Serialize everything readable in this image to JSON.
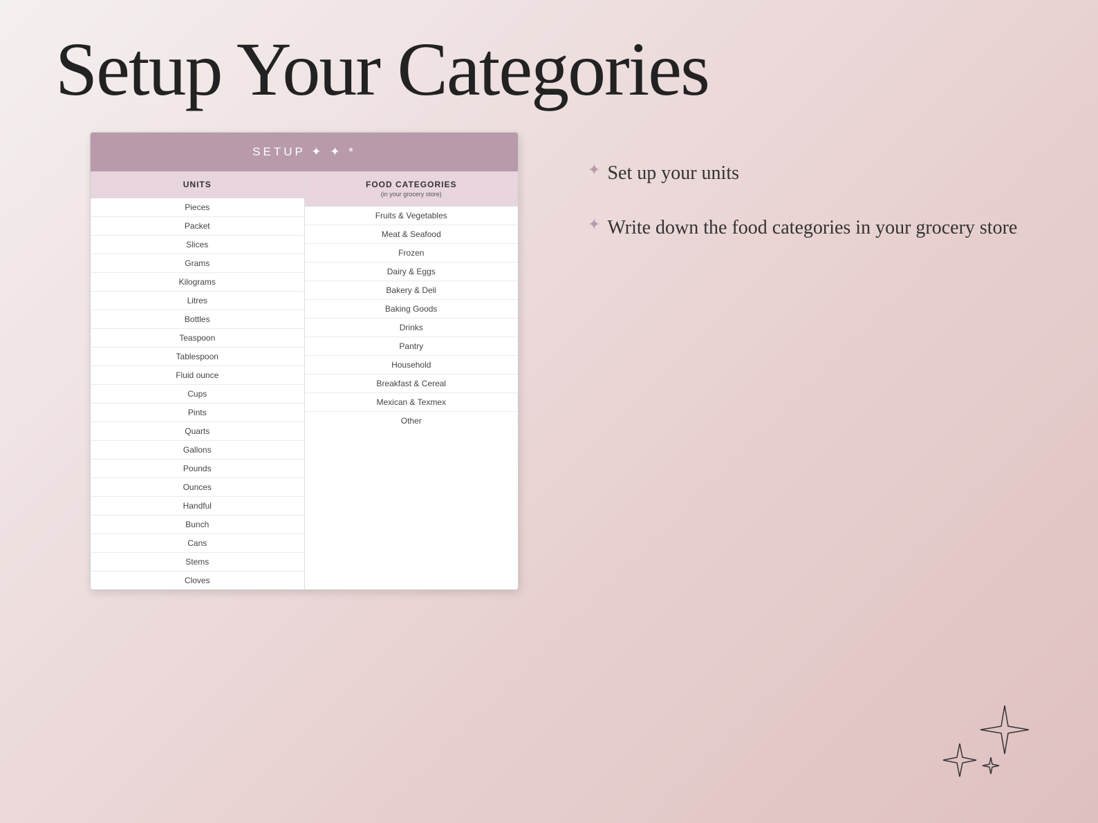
{
  "page": {
    "title": "Setup Your Categories",
    "background": "linear-gradient pink"
  },
  "card": {
    "header": "SETUP ✦ ✦ *",
    "units_col_header": "UNITS",
    "food_col_header": "FOOD CATEGORIES",
    "food_col_subheader": "(in your grocery store)",
    "units": [
      "Pieces",
      "Packet",
      "Slices",
      "Grams",
      "Kilograms",
      "Litres",
      "Bottles",
      "Teaspoon",
      "Tablespoon",
      "Fluid ounce",
      "Cups",
      "Pints",
      "Quarts",
      "Gallons",
      "Pounds",
      "Ounces",
      "Handful",
      "Bunch",
      "Cans",
      "Stems",
      "Cloves"
    ],
    "food_categories": [
      "Fruits & Vegetables",
      "Meat & Seafood",
      "Frozen",
      "Dairy & Eggs",
      "Bakery & Deli",
      "Baking Goods",
      "Drinks",
      "Pantry",
      "Household",
      "Breakfast & Cereal",
      "Mexican & Texmex",
      "Other"
    ]
  },
  "info_panel": {
    "items": [
      {
        "icon": "✦",
        "text": "Set up your units"
      },
      {
        "icon": "✦",
        "text": "Write down the food categories in your grocery store"
      }
    ]
  }
}
